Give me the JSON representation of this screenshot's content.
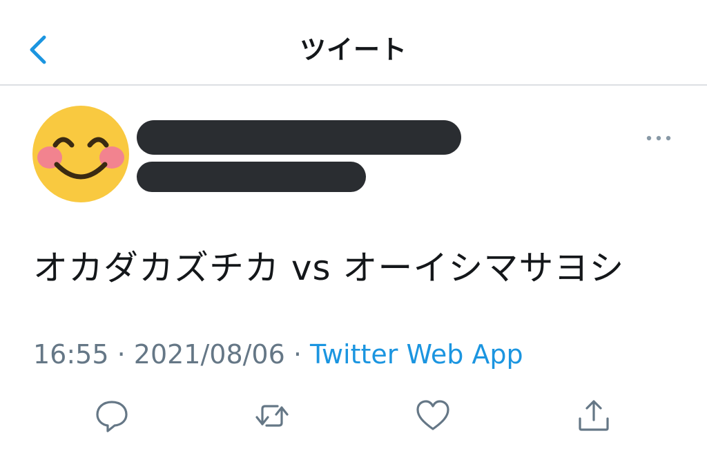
{
  "header": {
    "title": "ツイート"
  },
  "tweet": {
    "text": "オカダカズチカ vs オーイシマサヨシ",
    "time": "16:55",
    "separator1": " · ",
    "date": "2021/08/06",
    "separator2": " · ",
    "source": "Twitter Web App"
  },
  "icons": {
    "back": "chevron-left-icon",
    "more": "more-icon",
    "reply": "reply-icon",
    "retweet": "retweet-icon",
    "like": "heart-icon",
    "share": "share-icon"
  },
  "colors": {
    "accent": "#1b95e0",
    "muted": "#657786",
    "text": "#14171a",
    "redaction": "#2a2d31",
    "divider": "#dcdfe3"
  }
}
